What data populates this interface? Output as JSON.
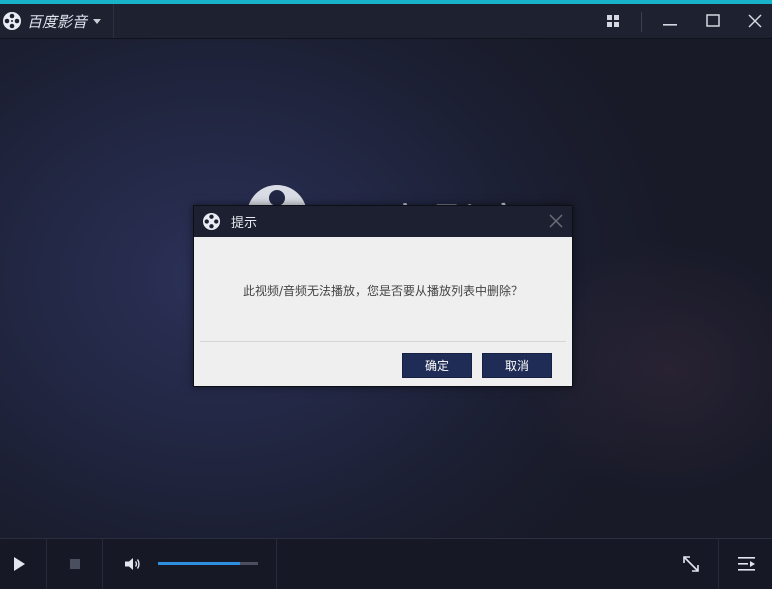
{
  "app": {
    "name": "百度影音"
  },
  "background": {
    "title": "百度影音"
  },
  "dialog": {
    "title": "提示",
    "message": "此视频/音频无法播放，您是否要从播放列表中删除？",
    "confirm_label": "确定",
    "cancel_label": "取消"
  },
  "controls": {
    "volume_level": 0.82
  },
  "colors": {
    "accent": "#19b3c9",
    "volume": "#2e8fe0",
    "button": "#1f2c55"
  },
  "icons": [
    "film-reel-icon",
    "chevron-down-icon",
    "grid-icon",
    "minimize-icon",
    "maximize-icon",
    "close-icon",
    "play-icon",
    "stop-icon",
    "volume-icon",
    "fullscreen-icon",
    "playlist-icon"
  ]
}
